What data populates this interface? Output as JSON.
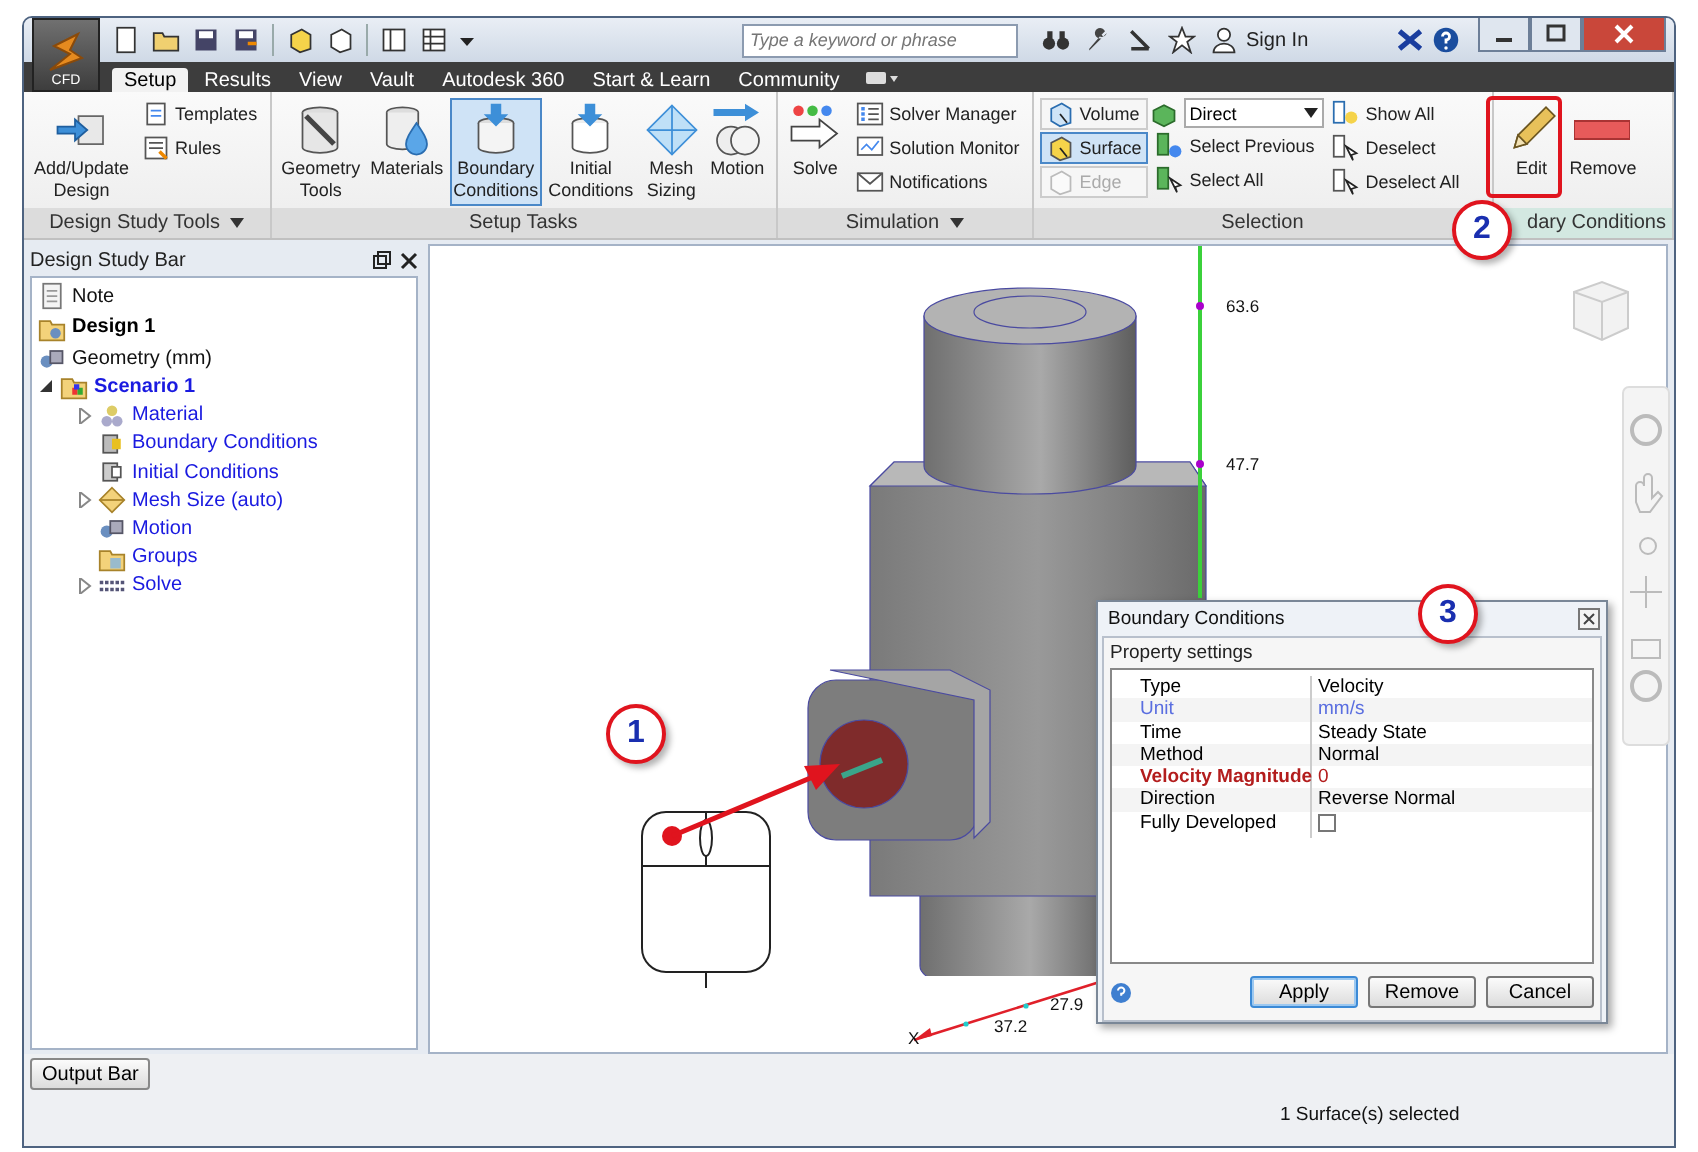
{
  "app_button": {
    "label": "CFD"
  },
  "title_bar": {
    "search": {
      "placeholder": "Type a keyword or phrase"
    },
    "sign_in": "Sign In"
  },
  "tabs": [
    {
      "label": "Setup",
      "selected": true
    },
    {
      "label": "Results",
      "selected": false
    },
    {
      "label": "View",
      "selected": false
    },
    {
      "label": "Vault",
      "selected": false
    },
    {
      "label": "Autodesk 360",
      "selected": false
    },
    {
      "label": "Start & Learn",
      "selected": false
    },
    {
      "label": "Community",
      "selected": false
    }
  ],
  "ribbon": {
    "panels": [
      {
        "title": "Design Study Tools",
        "menu": true,
        "columns": [
          [
            {
              "label": "Add/Update Design",
              "kind": "large",
              "selected": false,
              "disabled": false
            }
          ],
          [
            {
              "label": "Templates",
              "kind": "small",
              "selected": false,
              "disabled": false
            },
            {
              "label": "Rules",
              "kind": "small",
              "selected": false,
              "disabled": false
            }
          ]
        ]
      },
      {
        "title": "Setup Tasks",
        "columns": [
          [
            {
              "label": "Geometry Tools",
              "kind": "large",
              "selected": false,
              "disabled": false
            }
          ],
          [
            {
              "label": "Materials",
              "kind": "large",
              "selected": false,
              "disabled": false
            }
          ],
          [
            {
              "label": "Boundary Conditions",
              "kind": "large",
              "selected": true,
              "disabled": false
            }
          ],
          [
            {
              "label": "Initial Conditions",
              "kind": "large",
              "selected": false,
              "disabled": false
            }
          ],
          [
            {
              "label": "Mesh Sizing",
              "kind": "large",
              "selected": false,
              "disabled": false
            }
          ],
          [
            {
              "label": "Motion",
              "kind": "large",
              "selected": false,
              "disabled": false
            }
          ]
        ]
      },
      {
        "title": "Simulation",
        "menu": true,
        "columns": [
          [
            {
              "label": "Solve",
              "kind": "large",
              "selected": false,
              "disabled": false
            }
          ],
          [
            {
              "label": "Solver Manager",
              "kind": "small",
              "selected": false,
              "disabled": false
            },
            {
              "label": "Solution Monitor",
              "kind": "small",
              "selected": false,
              "disabled": false
            },
            {
              "label": "Notifications",
              "kind": "small",
              "selected": false,
              "disabled": false
            }
          ]
        ]
      },
      {
        "title": "Selection",
        "columns": [
          [
            {
              "label": "Volume",
              "kind": "toggle",
              "selected": false,
              "disabled": false
            },
            {
              "label": "Surface",
              "kind": "toggle",
              "selected": true,
              "disabled": false
            },
            {
              "label": "Edge",
              "kind": "toggle",
              "selected": false,
              "disabled": true
            }
          ],
          [
            {
              "label": "Direct",
              "kind": "dropdown",
              "selected": false,
              "disabled": false
            },
            {
              "label": "Select Previous",
              "kind": "small",
              "selected": false,
              "disabled": false
            },
            {
              "label": "Select All",
              "kind": "small",
              "selected": false,
              "disabled": false
            }
          ],
          [
            {
              "label": "Show All",
              "kind": "small",
              "selected": false,
              "disabled": false
            },
            {
              "label": "Deselect",
              "kind": "small",
              "selected": false,
              "disabled": false
            },
            {
              "label": "Deselect All",
              "kind": "small",
              "selected": false,
              "disabled": false
            }
          ]
        ]
      },
      {
        "title": "dary Conditions",
        "columns": [
          [
            {
              "label": "Edit",
              "kind": "large",
              "selected": false,
              "disabled": false
            }
          ],
          [
            {
              "label": "Remove",
              "kind": "large",
              "selected": false,
              "disabled": false
            }
          ]
        ]
      }
    ]
  },
  "design_study_bar": {
    "title": "Design Study Bar",
    "tree": [
      {
        "label": "Note",
        "kind": "plain"
      },
      {
        "label": "Design 1",
        "kind": "design"
      },
      {
        "label": "Geometry (mm)",
        "kind": "plain"
      },
      {
        "label": "Scenario 1",
        "kind": "scenario",
        "expanded": true,
        "children": [
          {
            "label": "Material",
            "kind": "setting",
            "expanded": false
          },
          {
            "label": "Boundary Conditions",
            "kind": "setting"
          },
          {
            "label": "Initial Conditions",
            "kind": "setting"
          },
          {
            "label": "Mesh Size (auto)",
            "kind": "setting",
            "expanded": false
          },
          {
            "label": "Motion",
            "kind": "setting"
          },
          {
            "label": "Groups",
            "kind": "setting"
          },
          {
            "label": "Solve",
            "kind": "setting",
            "expanded": false
          }
        ]
      }
    ]
  },
  "viewport": {
    "axis_labels": [
      "63.6",
      "47.7",
      "27.9",
      "37.2",
      "X"
    ]
  },
  "dialog": {
    "title": "Boundary Conditions",
    "group": "Property settings",
    "rows": [
      {
        "name": "Type",
        "kind": "text",
        "units": false,
        "required": false,
        "value": "Velocity"
      },
      {
        "name": "Unit",
        "kind": "text",
        "units": true,
        "required": false,
        "value": "mm/s"
      },
      {
        "name": "Time",
        "kind": "text",
        "units": false,
        "required": false,
        "value": "Steady State"
      },
      {
        "name": "Method",
        "kind": "text",
        "units": false,
        "required": false,
        "value": "Normal"
      },
      {
        "name": "Velocity Magnitude",
        "kind": "text",
        "units": false,
        "required": true,
        "value": "0"
      },
      {
        "name": "Direction",
        "kind": "text",
        "units": false,
        "required": false,
        "value": "Reverse Normal"
      },
      {
        "name": "Fully Developed",
        "kind": "checkbox",
        "units": false,
        "required": false,
        "checked": false
      }
    ],
    "buttons": [
      {
        "label": "Apply",
        "default": true
      },
      {
        "label": "Remove",
        "default": false
      },
      {
        "label": "Cancel",
        "default": false
      }
    ]
  },
  "output_bar": {
    "label": "Output Bar"
  },
  "status_bar": {
    "text": "1 Surface(s) selected"
  },
  "callouts": [
    "1",
    "2",
    "3"
  ]
}
